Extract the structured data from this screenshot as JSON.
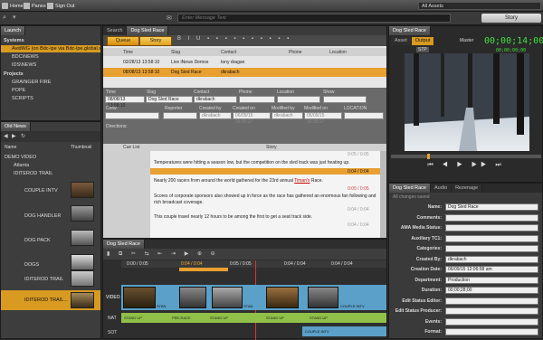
{
  "topbar": {
    "home": "Home",
    "panes": "Panes",
    "signout": "Sign Out",
    "assets": "All Assets"
  },
  "search": {
    "placeholder": "Enter Message Text",
    "story_btn": "Story"
  },
  "launch": {
    "tab": "Launch",
    "systems": "Systems",
    "sys": [
      "AvidWG (on Bdc-ipe via Bdc-ipe.global.s",
      "BDC\\NEWS",
      "IDS\\NEWS"
    ],
    "projects": "Projects",
    "proj": [
      "GRAINGER FIRE",
      "POPE",
      "SCRIPTS"
    ]
  },
  "bin": {
    "tab": "Old News",
    "col_name": "Name",
    "col_thumb": "Thumbnail",
    "root": "DEMO VIDEO",
    "folders": [
      "Atlanta",
      "IDITEROD TRAIL"
    ],
    "items": [
      "COUPLE INTV",
      "DOG HANDLER",
      "DOG PACK",
      "DOGS",
      "IDITEROD TRAIL",
      "IDITEROD TRAIL..."
    ]
  },
  "queue": {
    "tab1": "Search",
    "tab2": "Dog Sled Race",
    "queue_btn": "Queue",
    "story_btn": "Story",
    "cols": [
      "Time",
      "Slug",
      "Contact",
      "Phone",
      "Location"
    ],
    "rows": [
      [
        "03/28/13 13:58:10",
        "Live iNews Demos",
        "tony dragan"
      ],
      [
        "08/08/13 13:58:10",
        "Dog Sled Race",
        "dkrabach"
      ]
    ]
  },
  "form": {
    "labels": [
      "Time",
      "Slug",
      "Contact",
      "Phone",
      "Location",
      "Show"
    ],
    "time": "08/08/13 13:58:10",
    "slug": "Dog Sled Race",
    "contact": "dkrabach",
    "labels2": [
      "Crew:",
      "Reporter",
      "Created by",
      "Created on",
      "Modified by",
      "Modified on",
      "LOCATION"
    ],
    "created_by": "dkrabach",
    "created_on": "06/09/15 06:05:27",
    "modified_by": "dkrabach",
    "modified_on": "06/09/15 06:05:27",
    "directions": "Directions:",
    "cue": "Cue List",
    "story": "Story"
  },
  "story": {
    "t1": "0:05 / 0:05",
    "p1": "Temperatures were hitting a season low, but the competition on the sled track was just heating up.",
    "t2": "0:04 / 0:04",
    "p2a": "Nearly 200 racers from around the world gathered for the 23rd annual ",
    "p2b": "Timan's",
    "p2c": " Race.",
    "t3": "0:05 / 0:05",
    "p3": "Scores of corporate sponsors also showed up in force as the race has gathered an enormous fan following and rich broadcast coverage.",
    "t4": "0:04 / 0:04",
    "p4": "This couple travel nearly 12 hours to be among the first to get a seat track side.",
    "t5": "0:04 / 0:04"
  },
  "timeline": {
    "tab": "Dog Sled Race",
    "times": [
      "0:00 / 0:05",
      "0:04 / 0:04",
      "0:05 / 0:05",
      "0:04 / 0:04",
      "0:04 / 0:04"
    ],
    "tracks": [
      "VIDEO",
      "NAT",
      "SOT"
    ],
    "clips": [
      "STAN",
      "STAN",
      "COUPLE INTV"
    ],
    "nat": [
      "STAND UP",
      "PRE-RACE",
      "STAND UP",
      "STAND UP",
      "STAND UP"
    ],
    "sot": "COUPLE INTV"
  },
  "monitor": {
    "tab": "Dog Sled Race",
    "asset": "Asset",
    "output": "Output",
    "master": "Master",
    "timecode": "00;00;14;00",
    "tc_small": "00;00;00;00",
    "std": "STP"
  },
  "meta": {
    "tab1": "Dog Sled Race",
    "tab2": "Audio",
    "tab3": "Rezenage",
    "changes": "All changes saved",
    "fields": [
      [
        "Name:",
        "Dog Sled Race"
      ],
      [
        "Comments:",
        ""
      ],
      [
        "AMA Media Status:",
        ""
      ],
      [
        "Auxiliary TC1:",
        ""
      ],
      [
        "Categories:",
        ""
      ],
      [
        "Created By:",
        "dkrabach"
      ],
      [
        "Creation Date:",
        "06/09/15 12:06:58 am"
      ],
      [
        "Department:",
        "Production"
      ],
      [
        "Duration:",
        "00;00;28;00"
      ],
      [
        "Edit Status Editor:",
        ""
      ],
      [
        "Edit Status Producer:",
        ""
      ],
      [
        "Events:",
        ""
      ],
      [
        "Format:",
        ""
      ]
    ]
  }
}
